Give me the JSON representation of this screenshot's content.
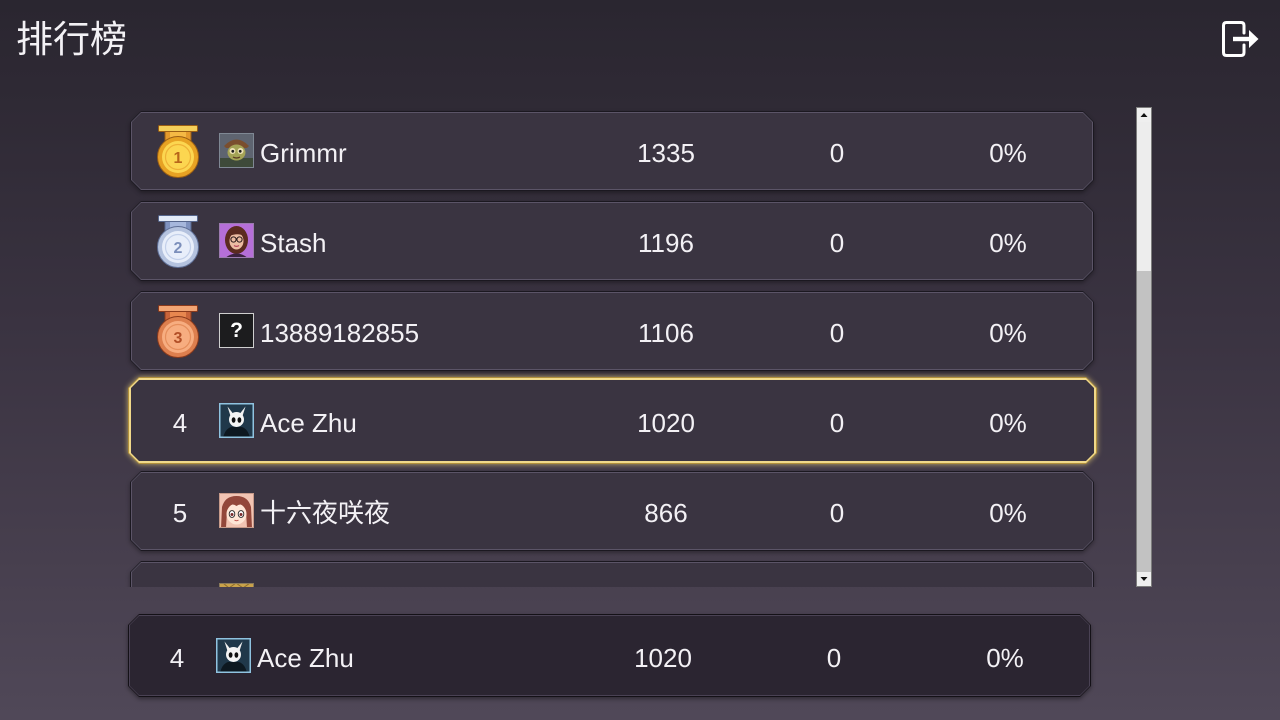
{
  "header": {
    "title": "排行榜",
    "exit_icon": "exit-icon"
  },
  "leaderboard": {
    "rows": [
      {
        "rank": "1",
        "medal_icon": "gold-medal-icon",
        "avatar_icon": "avatar-creature-portrait-icon",
        "name": "Grimmr",
        "score": "1335",
        "count": "0",
        "percent": "0%"
      },
      {
        "rank": "2",
        "medal_icon": "silver-medal-icon",
        "avatar_icon": "avatar-woman-with-glasses-icon",
        "name": "Stash",
        "score": "1196",
        "count": "0",
        "percent": "0%"
      },
      {
        "rank": "3",
        "medal_icon": "bronze-medal-icon",
        "avatar_icon": "avatar-question-mark-icon",
        "avatar_text": "?",
        "name": "13889182855",
        "score": "1106",
        "count": "0",
        "percent": "0%"
      },
      {
        "rank": "4",
        "avatar_icon": "avatar-horned-knight-icon",
        "name": "Ace Zhu",
        "score": "1020",
        "count": "0",
        "percent": "0%",
        "highlighted": true
      },
      {
        "rank": "5",
        "avatar_icon": "avatar-anime-girl-icon",
        "name": "十六夜咲夜",
        "score": "866",
        "count": "0",
        "percent": "0%"
      }
    ],
    "partial_row": {
      "avatar_icon": "avatar-gold-portrait-icon"
    }
  },
  "current_player": {
    "rank": "4",
    "avatar_icon": "avatar-horned-knight-icon",
    "name": "Ace Zhu",
    "score": "1020",
    "count": "0",
    "percent": "0%"
  },
  "scrollbar": {
    "up_icon": "scroll-up-arrow-icon",
    "down_icon": "scroll-down-arrow-icon",
    "thumb_fraction": 0.33,
    "scroll_fraction": 0
  },
  "colors": {
    "text": "#f3f1f5",
    "row_fill": "#3a3441",
    "highlight_border": "#f0d98a",
    "medal_gold": "#fcd650",
    "medal_silver": "#e8eefa",
    "medal_bronze": "#f7ad80"
  }
}
